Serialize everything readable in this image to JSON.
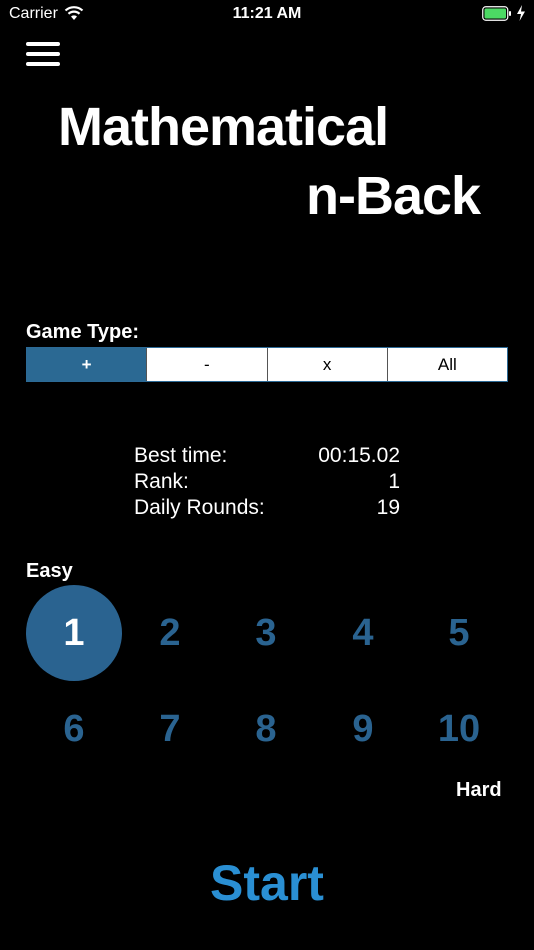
{
  "status_bar": {
    "carrier": "Carrier",
    "time": "11:21 AM",
    "battery_color": "#4cd964"
  },
  "header": {
    "title_line1": "Mathematical",
    "title_line2": "n-Back"
  },
  "game_type": {
    "label": "Game Type:",
    "options": [
      "+",
      "-",
      "x",
      "All"
    ],
    "selected": "+"
  },
  "stats": {
    "best_time_label": "Best time:",
    "best_time_value": "00:15.02",
    "rank_label": "Rank:",
    "rank_value": "1",
    "daily_rounds_label": "Daily Rounds:",
    "daily_rounds_value": "19"
  },
  "difficulty": {
    "easy_label": "Easy",
    "hard_label": "Hard",
    "levels": [
      "1",
      "2",
      "3",
      "4",
      "5",
      "6",
      "7",
      "8",
      "9",
      "10"
    ],
    "selected": "1"
  },
  "start_label": "Start",
  "colors": {
    "accent": "#2a6390",
    "start": "#2a8fd3",
    "background": "#000000"
  }
}
